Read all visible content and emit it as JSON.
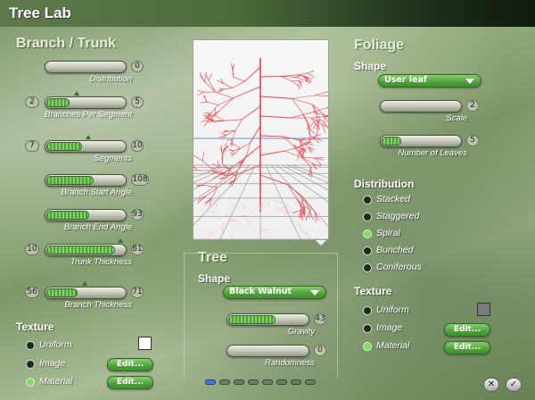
{
  "app": {
    "title": "Tree Lab"
  },
  "branch": {
    "title": "Branch / Trunk",
    "sliders": [
      {
        "label": "Distribution",
        "value": "0",
        "fill": 0.0
      },
      {
        "label": "Branches Per Segment",
        "min": "2",
        "value": "5",
        "fill": 0.3
      },
      {
        "label": "Segments",
        "min": "7",
        "value": "10",
        "fill": 0.45
      },
      {
        "label": "Branch Start Angle",
        "value": "108",
        "fill": 0.6
      },
      {
        "label": "Branch End Angle",
        "value": "93",
        "fill": 0.55
      },
      {
        "label": "Trunk Thickness",
        "min": "10",
        "value": "81",
        "fill": 0.88
      },
      {
        "label": "Branch Thickness",
        "min": "56",
        "value": "71",
        "fill": 0.4
      }
    ],
    "texture": {
      "title": "Texture",
      "options": [
        {
          "label": "Uniform",
          "selected": false
        },
        {
          "label": "Image",
          "selected": false
        },
        {
          "label": "Material",
          "selected": true
        }
      ],
      "edit_label": "Edit...",
      "swatch_color": "#ffffff"
    }
  },
  "tree": {
    "title": "Tree",
    "shape_title": "Shape",
    "shape_value": "Black Walnut",
    "sliders": [
      {
        "label": "Gravity",
        "value": "43",
        "fill": 0.6
      },
      {
        "label": "Randomness",
        "value": "0",
        "fill": 0.0
      }
    ]
  },
  "foliage": {
    "title": "Foliage",
    "shape_title": "Shape",
    "shape_value": "User leaf",
    "sliders": [
      {
        "label": "Scale",
        "value": "2",
        "fill": 0.0
      },
      {
        "label": "Number of Leaves",
        "value": "5",
        "fill": 0.25
      }
    ],
    "distribution": {
      "title": "Distribution",
      "options": [
        {
          "label": "Stacked",
          "selected": false
        },
        {
          "label": "Staggered",
          "selected": false
        },
        {
          "label": "Spiral",
          "selected": true
        },
        {
          "label": "Bunched",
          "selected": false
        },
        {
          "label": "Coniferous",
          "selected": false
        }
      ]
    },
    "texture": {
      "title": "Texture",
      "options": [
        {
          "label": "Uniform",
          "selected": false
        },
        {
          "label": "Image",
          "selected": false
        },
        {
          "label": "Material",
          "selected": true
        }
      ],
      "edit_label": "Edit...",
      "swatch_color": "#7a7a7a"
    }
  },
  "footer": {
    "cancel_icon": "close-icon",
    "ok_icon": "check-icon"
  }
}
